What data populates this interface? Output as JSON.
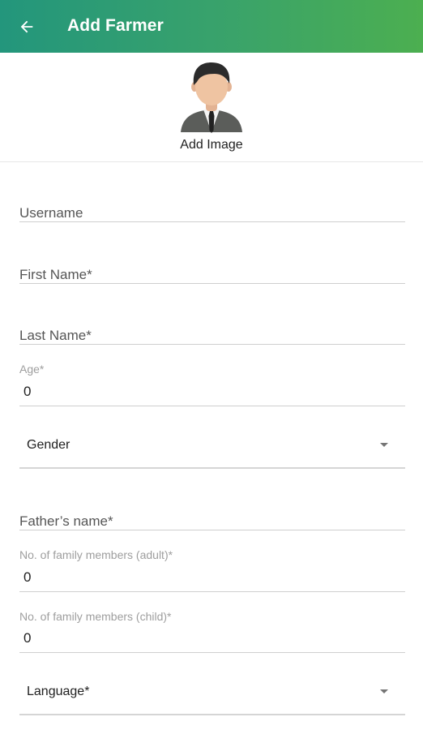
{
  "appbar": {
    "title": "Add Farmer",
    "back_icon": "arrow-left-icon",
    "gradient": [
      "#23967c",
      "#4caf50"
    ]
  },
  "avatar": {
    "icon": "person-avatar-icon",
    "label": "Add Image"
  },
  "form": {
    "username": {
      "placeholder": "Username"
    },
    "first_name": {
      "placeholder": "First Name*"
    },
    "last_name": {
      "placeholder": "Last Name*"
    },
    "age": {
      "label": "Age*",
      "value": "0"
    },
    "gender": {
      "selected": "Gender",
      "icon": "dropdown-arrow-icon"
    },
    "father_name": {
      "placeholder": "Father’s name*"
    },
    "family_adult": {
      "label": "No. of family members (adult)*",
      "value": "0"
    },
    "family_child": {
      "label": "No. of family members (child)*",
      "value": "0"
    },
    "language": {
      "selected": "Language*",
      "icon": "dropdown-arrow-icon"
    }
  }
}
